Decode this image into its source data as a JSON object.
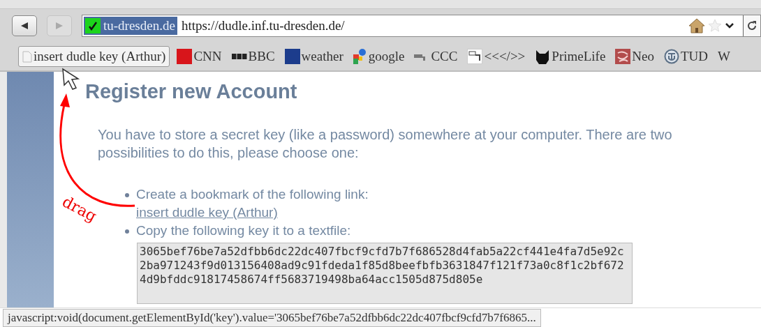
{
  "toolbar": {
    "back_disabled": false,
    "forward_disabled": true
  },
  "address_bar": {
    "identity": "tu-dresden.de",
    "url": "https://dudle.inf.tu-dresden.de/"
  },
  "bookmarks": [
    {
      "label": "insert dudle key (Arthur)",
      "selected": true
    },
    {
      "label": "CNN",
      "selected": false
    },
    {
      "label": "BBC",
      "selected": false
    },
    {
      "label": "weather",
      "selected": false
    },
    {
      "label": "google",
      "selected": false
    },
    {
      "label": "CCC",
      "selected": false
    },
    {
      "label": "<<</>>",
      "selected": false
    },
    {
      "label": "PrimeLife",
      "selected": false
    },
    {
      "label": "Neo",
      "selected": false
    },
    {
      "label": "TUD",
      "selected": false
    },
    {
      "label": "W",
      "selected": false
    }
  ],
  "page": {
    "title": "Register new Account",
    "intro": "You have to store a secret key (like a password) somewhere at your computer. There are two possibilities to do this, please choose one:",
    "options": [
      {
        "text": "Create a bookmark of the following link:",
        "link": "insert dudle key (Arthur)"
      },
      {
        "text": "Copy the following key it to a textfile:"
      }
    ],
    "key_field": {
      "value": "3065bef76be7a52dfbb6dc22dc407fbcf9cfd7b7f686528d4fab5a22cf441e4fa7d5e92c\n2ba971243f9d013156408ad9c91fdeda1f85d8beefbfb3631847f121f73a0c8f1c2bf672\n4d9bfddc91817458674ff5683719498ba64acc1505d875d805e"
    }
  },
  "drag_label": "drag",
  "status_bar": "javascript:void(document.getElementById('key').value='3065bef76be7a52dfbb6dc22dc407fbcf9cfd7b7f6865..."
}
